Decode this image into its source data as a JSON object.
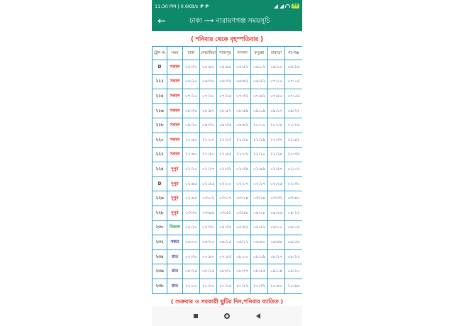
{
  "status": {
    "time": "11:30 PM | 0.6KB/s",
    "icons": "P P",
    "battery": "99"
  },
  "appbar": {
    "back_icon": "←",
    "title": "ঢাকা ⟿ নারায়ণগঞ্জ সময়সূচি"
  },
  "banner": "( শনিবার থেকে বৃহস্পতিবার )",
  "table": {
    "headers": [
      "ট্রেন নং",
      "সময়",
      "ঢাকা",
      "গেন্ডারিয়া",
      "শ্যামপুর",
      "পাগলা",
      "ফতুল্লা",
      "চাষাড়া",
      "না:গঞ্জ"
    ],
    "rows": [
      {
        "no": "D",
        "session": "সকাল",
        "type": "morning",
        "times": [
          "০৫:৩০",
          "০৫:৪০",
          "০৫:৪৫",
          "০৫:৫২",
          "০৬:০২",
          "০৬:১০",
          "০৬:১৫"
        ]
      },
      {
        "no": "২১২",
        "session": "সকাল",
        "type": "morning",
        "times": [
          "০৬:২০",
          "০৬:৩০",
          "০৬:৩৫",
          "০৬:৪২",
          "০৬:৫২",
          "০৭:০০",
          "০৭:০৫"
        ]
      },
      {
        "no": "২১৪",
        "session": "সকাল",
        "type": "morning",
        "times": [
          "০৭:১০",
          "০৭:২০",
          "০৭:২৫",
          "০৭:৩২",
          "০৭:৪২",
          "০৭:৫০",
          "০৭:৫৫"
        ]
      },
      {
        "no": "২১৬",
        "session": "সকাল",
        "type": "morning",
        "times": [
          "০৮:৩০",
          "০৮:৪৭",
          "০৮:৫২",
          "০৮:৫৯",
          "০৯:০৯",
          "০৯:১৭",
          "০৯:২২"
        ]
      },
      {
        "no": "২১৮",
        "session": "সকাল",
        "type": "morning",
        "times": [
          "০৯:২০",
          "০৯:৩০",
          "০৯:৩৫",
          "০৯:৪২",
          "১০:০০",
          "১০:০৮",
          "১০:১৫"
        ]
      },
      {
        "no": "২২০",
        "session": "সকাল",
        "type": "morning",
        "times": [
          "১০:৫০",
          "১১:০৭",
          "১১:১৩",
          "১১:১৮",
          "১১:২৯",
          "১১:৩৭",
          "১১:৪২"
        ]
      },
      {
        "no": "২২২",
        "session": "সকাল",
        "type": "morning",
        "times": [
          "১১:৪০",
          "১১:৫০",
          "১১:৫৫",
          "১২:০১",
          "১২:২০",
          "১২:২৮",
          "১২:৩৫"
        ]
      },
      {
        "no": "২২৪",
        "session": "দুপুর",
        "type": "afternoon",
        "times": [
          "০১:১০",
          "০১:২৭",
          "০১:৩২",
          "০১:৩৯",
          "০১:৪৯",
          "০১:৫৭",
          "০২:০২"
        ]
      },
      {
        "no": "D",
        "session": "দুপুর",
        "type": "afternoon",
        "times": [
          "০১:৪৫",
          "০১:৫৫",
          "০২:০০",
          "০২:০৭",
          "০২:১৭",
          "০২:২৫",
          "০২:৩০"
        ]
      },
      {
        "no": "২২৬",
        "session": "দুপুর",
        "type": "afternoon",
        "times": [
          "০২:৪৫",
          "০৩:০২",
          "০৩:০৭",
          "০৩:১৪",
          "০৩:২৪",
          "০৩:৩২",
          "০৩:৪০"
        ]
      },
      {
        "no": "২২৮",
        "session": "দুপুর",
        "type": "afternoon",
        "times": [
          "০৩:৩০",
          "০৩:৪৬",
          "০৩:৫১",
          "০৩:৫৮",
          "০৪:০৮",
          "০৪:১৬",
          "০৪:২২"
        ]
      },
      {
        "no": "২৩০",
        "session": "বিকাল",
        "type": "bikal",
        "times": [
          "০৫:২০",
          "০৫:৩০",
          "০৫:৩৫",
          "০৫:৪২",
          "০৫:৫২",
          "০৬:০০",
          "০৬:০৫"
        ]
      },
      {
        "no": "২৩২",
        "session": "সন্ধ্যা",
        "type": "night",
        "times": [
          "০৬:০০",
          "০৬:১০",
          "০৬:১৫",
          "০৬:২২",
          "০৬:৪০",
          "০৬:৪৮",
          "০৬:৫৫"
        ]
      },
      {
        "no": "২৩৪",
        "session": "রাত",
        "type": "night",
        "times": [
          "০৭:৩০",
          "০৭:৪৭",
          "০৭:৫৩",
          "০৮:০০",
          "০৮:০৯",
          "০৮:১৭",
          "০৮:২২"
        ]
      },
      {
        "no": "২৩৬",
        "session": "রাত",
        "type": "night",
        "times": [
          "০৮:১৫",
          "০৮:২৫",
          "০৮:৩০",
          "০৮:৩৭",
          "০৮:৫৫",
          "০৯:০৪",
          "০৯:১০"
        ]
      },
      {
        "no": "২৩৮",
        "session": "রাত",
        "type": "night",
        "times": [
          "১০:০০",
          "১০:১০",
          "১০:১৫",
          "১০:২২",
          "১০:৩২",
          "১০:৪০",
          "১০:৪৫"
        ]
      }
    ]
  },
  "footer": "( শুক্রবার ও সরকারী ছুটির দিন,শনিবার ব্যাতিত )",
  "colors": {
    "primary": "#0e8a6a",
    "red": "#e0261f",
    "blue": "#2a55a8",
    "border": "#2e9fd4"
  }
}
